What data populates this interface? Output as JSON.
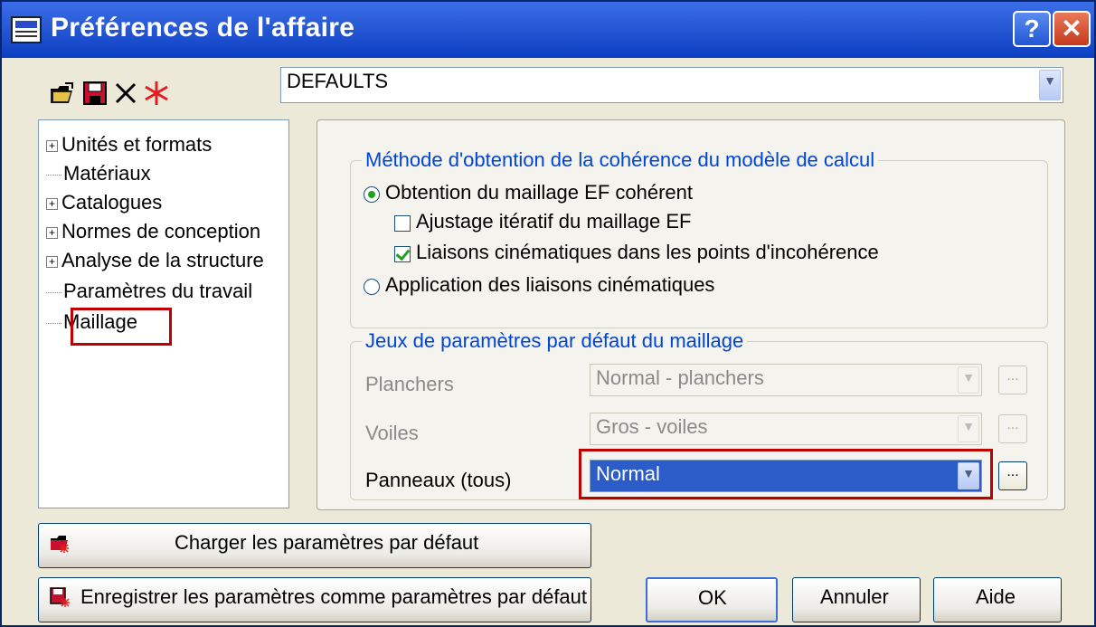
{
  "window": {
    "title": "Préférences de l'affaire",
    "help_label": "?",
    "close_label": "✕"
  },
  "toolbar": {
    "icons": [
      "open-folder-icon",
      "save-icon",
      "delete-icon",
      "new-star-icon"
    ]
  },
  "preset": {
    "value": "DEFAULTS"
  },
  "tree": {
    "items": [
      {
        "label": "Unités et formats",
        "expandable": true
      },
      {
        "label": "Matériaux",
        "expandable": false
      },
      {
        "label": "Catalogues",
        "expandable": true
      },
      {
        "label": "Normes de conception",
        "expandable": true
      },
      {
        "label": "Analyse de la structure",
        "expandable": true
      },
      {
        "label": "Paramètres du travail",
        "expandable": false
      },
      {
        "label": "Maillage",
        "expandable": false,
        "selected": true
      }
    ]
  },
  "coherence": {
    "legend": "Méthode d'obtention de la cohérence du modèle de calcul",
    "option1": "Obtention du maillage EF cohérent",
    "check1": "Ajustage itératif du maillage EF",
    "check2": "Liaisons cinématiques dans les points d'incohérence",
    "option2": "Application des liaisons cinématiques",
    "option1_selected": true,
    "check1_checked": false,
    "check2_checked": true
  },
  "mesh": {
    "legend": "Jeux de paramètres par défaut du maillage",
    "rows": [
      {
        "label": "Planchers",
        "value": "Normal - planchers",
        "enabled": false
      },
      {
        "label": "Voiles",
        "value": "Gros - voiles",
        "enabled": false
      },
      {
        "label": "Panneaux (tous)",
        "value": "Normal",
        "enabled": true
      }
    ],
    "ellipsis": "..."
  },
  "buttons": {
    "load": "Charger les paramètres par défaut",
    "save": "Enregistrer les paramètres comme paramètres par défaut",
    "ok": "OK",
    "cancel": "Annuler",
    "help": "Aide"
  },
  "colors": {
    "title_bar": "#0b3fc2",
    "highlight": "#c00000",
    "legend_text": "#0046d5",
    "selection": "#2b5cc8"
  }
}
